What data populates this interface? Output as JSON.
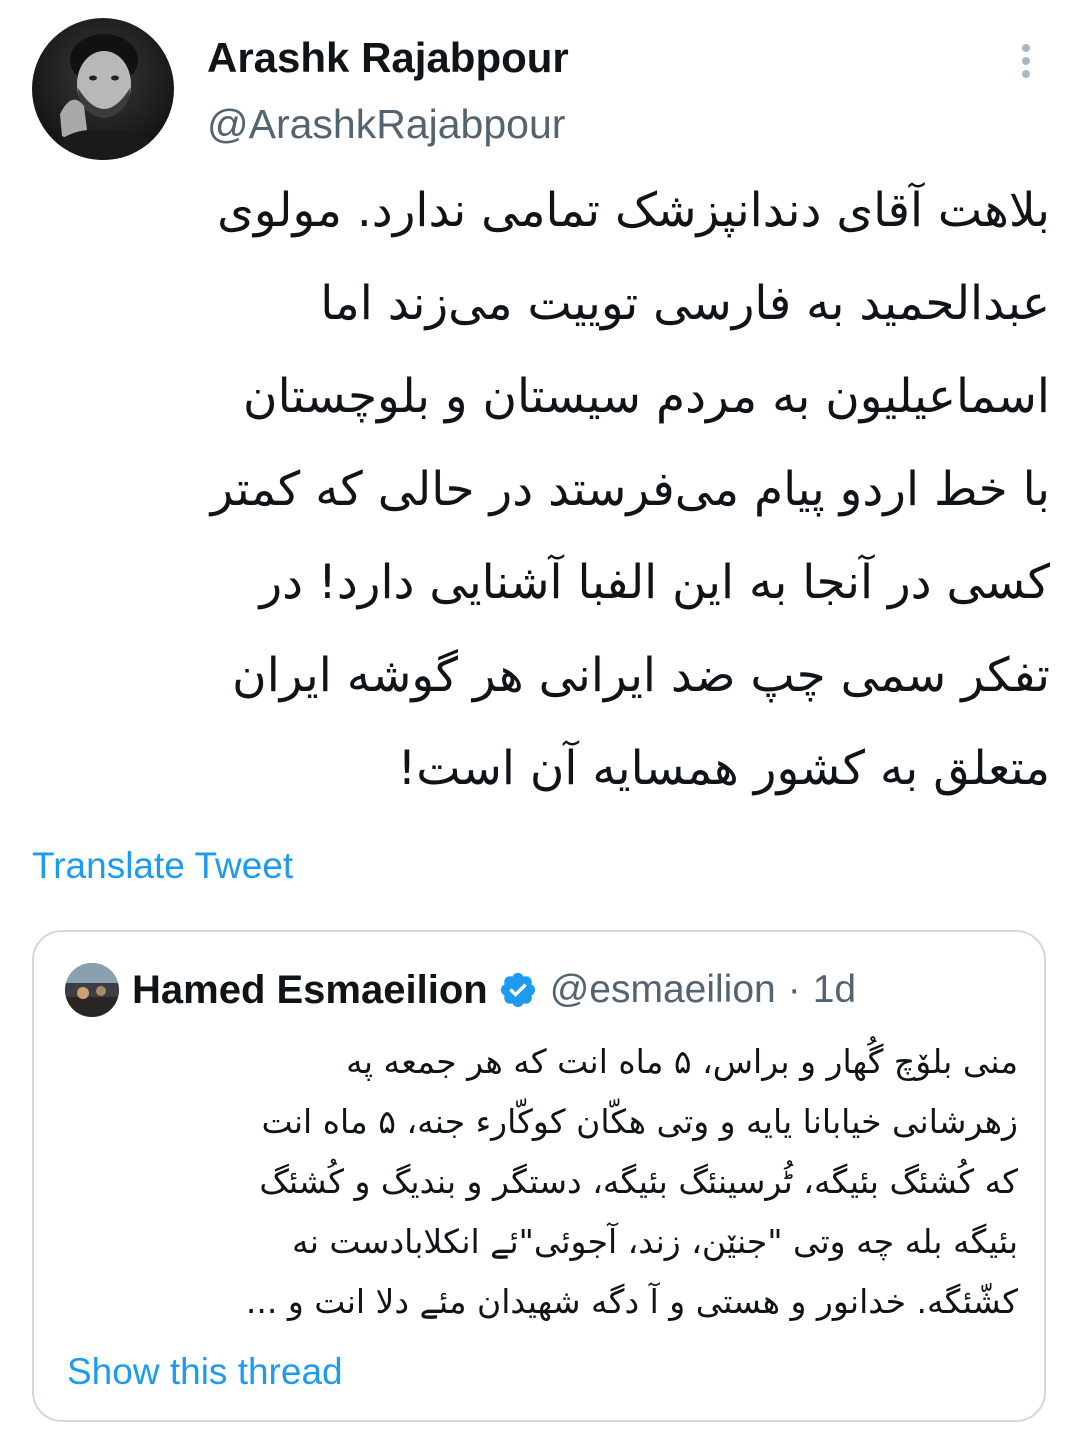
{
  "tweet": {
    "author": {
      "display_name": "Arashk Rajabpour",
      "handle": "@ArashkRajabpour",
      "avatar_icon": "profile-photo-avatar"
    },
    "more_icon": "vertical-ellipsis-icon",
    "body": "بلاهت آقای دندانپزشک تمامی ندارد. مولوی\nعبدالحمید به فارسی توییت می‌زند اما\nاسماعیلیون به مردم سیستان و بلوچستان\nبا خط اردو پیام می‌فرستد در حالی که کمتر\nکسی در آنجا به این الفبا آشنایی دارد! در\nتفکر سمی چپ ضد ایرانی هر گوشه ایران\nمتعلق به کشور همسایه آن است!",
    "translate_label": "Translate Tweet"
  },
  "quote": {
    "display_name": "Hamed Esmaeilion",
    "verified_icon": "verified-badge-icon",
    "handle": "@esmaeilion",
    "separator": "·",
    "time": "1d",
    "body": "منی بلۆچ گُهار و براس، ۵ ماه انت که هر جمعه په\nزهرشانی خیابانا یایه و وتی هکّان کوکّارء جنه، ۵ ماه انت\nکه کُشئگ بئیگه، ٹُرسینئگ بئیگه، دستگر و بندیگ و کُشئگ\nبئیگه بله چه وتی \"جنێن، زند، آجوئی\"ئے انکلابادست نه\nکشّئگه. خدانور و هستی و آ دگه شهیدان مئے دلا انت و ...",
    "show_thread_label": "Show this thread"
  },
  "colors": {
    "text_primary": "#0f1419",
    "text_secondary": "#536471",
    "link_blue": "#1d9bf0",
    "border": "#cfd9de",
    "background": "#ffffff"
  }
}
